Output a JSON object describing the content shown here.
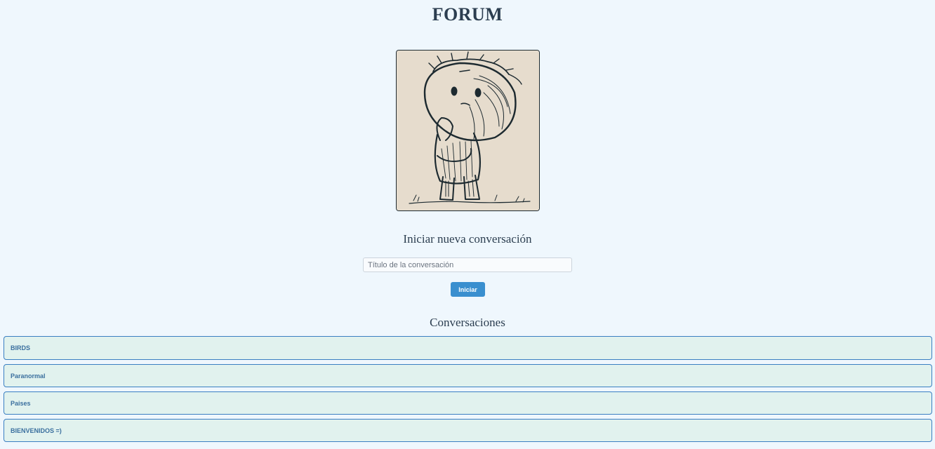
{
  "header": {
    "title": "FORUM"
  },
  "hero_image": {
    "description_icon": "thinking-character-sketch"
  },
  "new_conversation": {
    "heading": "Iniciar nueva conversación",
    "input_placeholder": "Título de la conversación",
    "input_value": "",
    "button_label": "Iniciar"
  },
  "conversations": {
    "heading": "Conversaciones",
    "items": [
      {
        "label": "BIRDS"
      },
      {
        "label": "Paranormal"
      },
      {
        "label": "Paises"
      },
      {
        "label": "BIENVENIDOS =)"
      }
    ]
  },
  "colors": {
    "background": "#eff7fd",
    "accent": "#3a8fcf",
    "item_background": "#e1f2ee",
    "item_border": "#3a7fc2",
    "heading_text": "#2c3e50"
  }
}
